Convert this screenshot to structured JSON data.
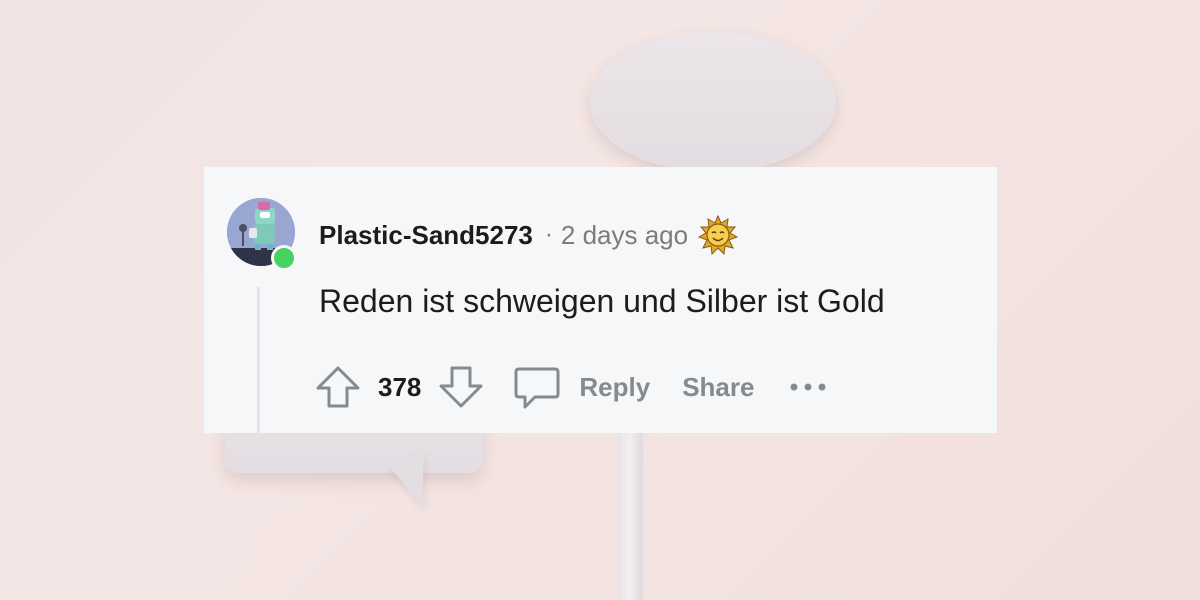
{
  "comment": {
    "username": "Plastic-Sand5273",
    "separator": "·",
    "timestamp": "2 days ago",
    "award_icon": "sun-award-icon",
    "body": "Reden ist schweigen und Silber ist Gold",
    "score": "378",
    "online": true
  },
  "actions": {
    "upvote_icon": "arrow-up-icon",
    "downvote_icon": "arrow-down-icon",
    "comment_icon": "speech-bubble-icon",
    "reply_label": "Reply",
    "share_label": "Share",
    "more_icon": "ellipsis-icon"
  },
  "colors": {
    "card_background": "#f6f7f9",
    "online_indicator": "#46d160",
    "text_primary": "#1c1c1c",
    "text_secondary": "#878a8c",
    "page_background": "#f2e4e2"
  }
}
